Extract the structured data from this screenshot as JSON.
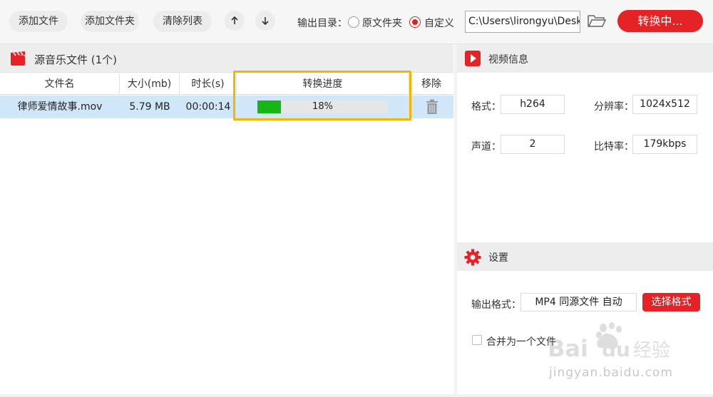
{
  "toolbar": {
    "add_file": "添加文件",
    "add_folder": "添加文件夹",
    "clear_list": "清除列表",
    "move_up_icon": "arrow-up-icon",
    "move_down_icon": "arrow-down-icon",
    "output_dir_label": "输出目录：",
    "radio_original": "原文件夹",
    "radio_custom": "自定义",
    "output_path": "C:\\Users\\lirongyu\\Desk",
    "convert_button": "转换中..."
  },
  "left_panel": {
    "title": "源音乐文件 (1个)",
    "columns": [
      "文件名",
      "大小(mb)",
      "时长(s)",
      "转换进度",
      "移除"
    ],
    "rows": [
      {
        "filename": "律师爱情故事.mov",
        "size": "5.79 MB",
        "duration": "00:00:14",
        "progress_text": "18%",
        "progress": 0.18
      }
    ]
  },
  "video_info": {
    "title": "视频信息",
    "format_label": "格式：",
    "format_value": "h264",
    "resolution_label": "分辨率：",
    "resolution_value": "1024x512",
    "channels_label": "声道：",
    "channels_value": "2",
    "bitrate_label": "比特率：",
    "bitrate_value": "179kbps"
  },
  "settings": {
    "title": "设置",
    "output_format_label": "输出格式：",
    "output_format_value": "MP4 同源文件 自动",
    "select_format_button": "选择格式",
    "merge_label": "合并为一个文件"
  },
  "watermark": {
    "logo": "Bai du 经验",
    "url": "jingyan.baidu.com"
  },
  "colors": {
    "accent": "#e52225",
    "progress": "#17b617",
    "highlight": "#f5b400",
    "row_selected": "#cfe7f8"
  }
}
